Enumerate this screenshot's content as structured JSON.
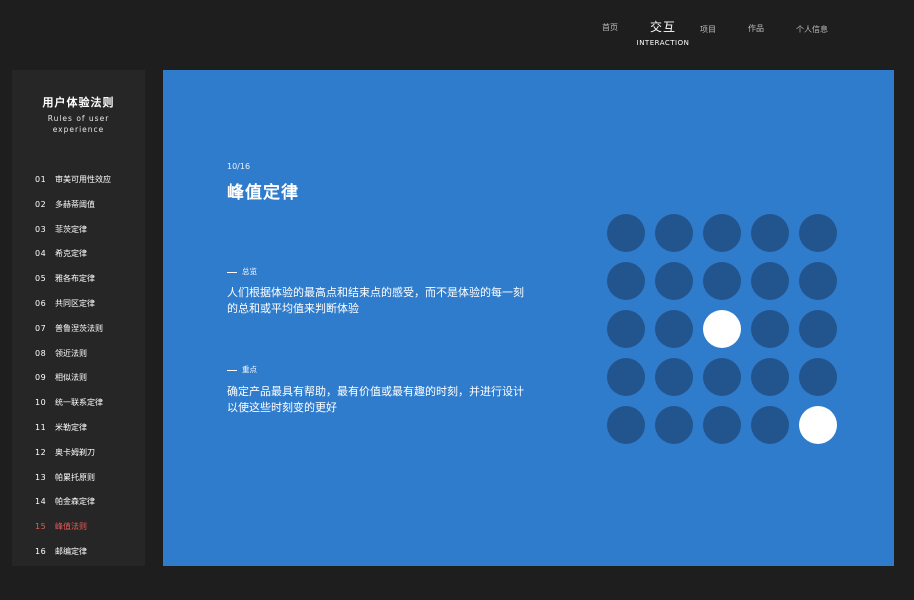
{
  "nav": {
    "home": "首页",
    "active_zh": "交互",
    "active_en": "INTERACTION",
    "projects": "项目",
    "works": "作品",
    "profile": "个人信息"
  },
  "sidebar": {
    "title": "用户体验法则",
    "subtitle": "Rules of user experience",
    "items": [
      {
        "num": "01",
        "label": "审美可用性效应"
      },
      {
        "num": "02",
        "label": "多赫蒂阈值"
      },
      {
        "num": "03",
        "label": "菲茨定律"
      },
      {
        "num": "04",
        "label": "希克定律"
      },
      {
        "num": "05",
        "label": "雅各布定律"
      },
      {
        "num": "06",
        "label": "共同区定律"
      },
      {
        "num": "07",
        "label": "普鲁涅茨法则"
      },
      {
        "num": "08",
        "label": "领近法则"
      },
      {
        "num": "09",
        "label": "相似法则"
      },
      {
        "num": "10",
        "label": "统一联系定律"
      },
      {
        "num": "11",
        "label": "米勒定律"
      },
      {
        "num": "12",
        "label": "奥卡姆剃刀"
      },
      {
        "num": "13",
        "label": "帕累托原则"
      },
      {
        "num": "14",
        "label": "帕金森定律"
      },
      {
        "num": "15",
        "label": "峰值法则"
      },
      {
        "num": "16",
        "label": "邮编定律"
      }
    ],
    "active_index": 14,
    "active_color": "#e85a5a"
  },
  "main": {
    "counter": "10/16",
    "title": "峰值定律",
    "overview_label": "总览",
    "overview_text": "人们根据体验的最高点和结束点的感受，而不是体验的每一刻的总和或平均值来判断体验",
    "key_label": "重点",
    "key_text": "确定产品最具有帮助，最有价值或最有趣的时刻，并进行设计以使这些时刻变的更好",
    "background_color": "#2f7ccd"
  },
  "dot_grid": {
    "rows": 5,
    "cols": 5,
    "highlighted": [
      [
        2,
        2
      ],
      [
        4,
        4
      ]
    ],
    "dot_color": "#22558d",
    "highlight_color": "#ffffff"
  }
}
